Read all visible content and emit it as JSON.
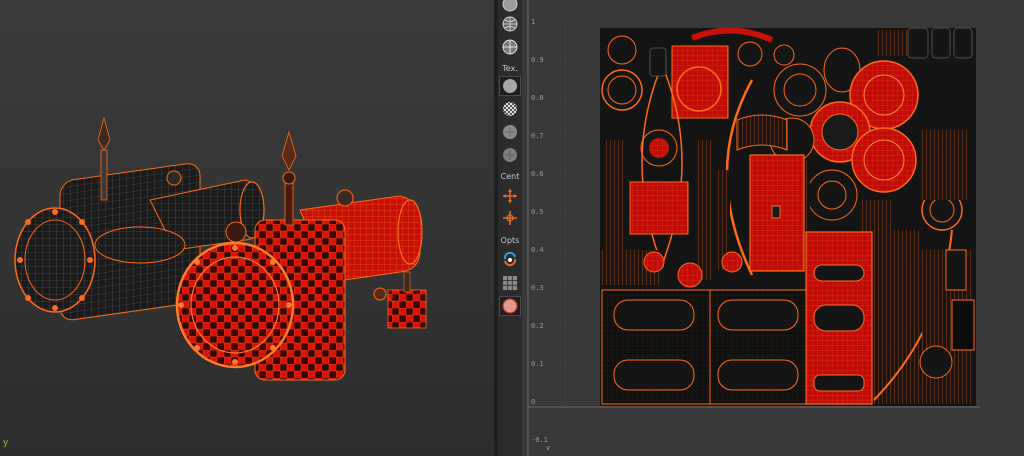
{
  "toolbar": {
    "tex_label": "Tex.",
    "cent_label": "Cent",
    "opts_label": "Opts"
  },
  "uv": {
    "v_ticks": [
      "1",
      "0.9",
      "0.8",
      "0.7",
      "0.6",
      "0.5",
      "0.4",
      "0.3",
      "0.2",
      "0.1",
      "0"
    ],
    "bottom_tick": "-0.1",
    "v_axis_label": "v"
  },
  "viewport": {
    "axis_label": "y"
  },
  "colors": {
    "selection": "#e8180c",
    "wire": "#ff6a1a",
    "background": "#2a2a2a",
    "accent_icon": "#e06a2a",
    "sync_icon": "#2f9de0"
  },
  "icons": [
    "sphere-shaded-icon",
    "sphere-wire-icon",
    "sphere-textured-icon",
    "checker-off-icon",
    "checker-on-icon",
    "checker-dim-icon",
    "checker-dim2-icon",
    "move-center-icon",
    "scale-center-icon",
    "uv-sync-icon",
    "grid-icon",
    "display-swatch-icon"
  ]
}
